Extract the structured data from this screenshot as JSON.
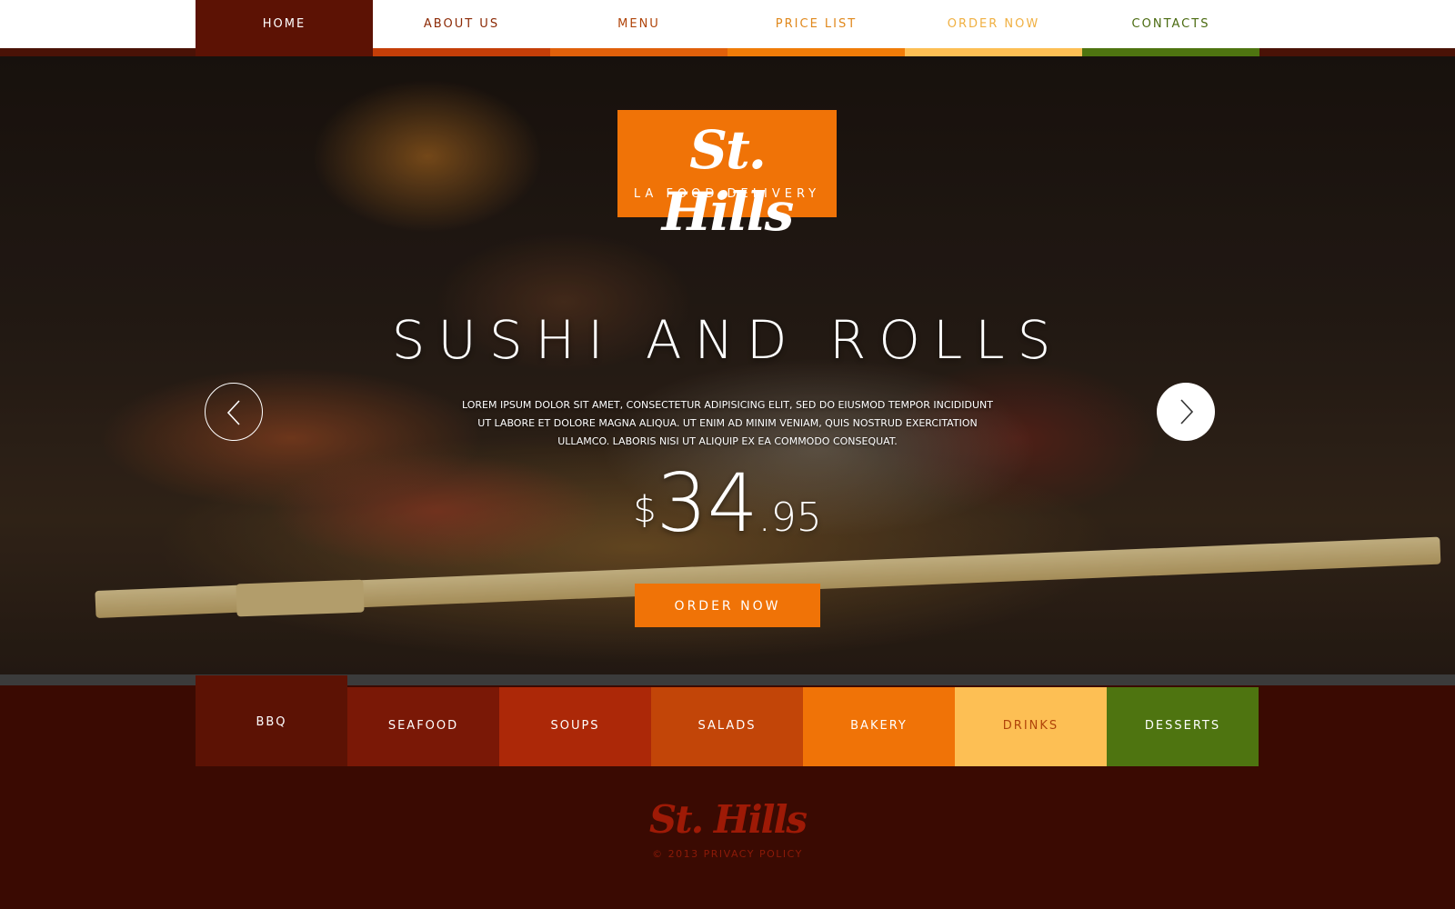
{
  "nav": {
    "items": [
      {
        "label": "HOME",
        "color": "#ffffff",
        "bar": "#5c1204",
        "active": true
      },
      {
        "label": "ABOUT US",
        "color": "#8c2a06",
        "bar": "#c43e08"
      },
      {
        "label": "MENU",
        "color": "#b0440a",
        "bar": "#e0600a"
      },
      {
        "label": "PRICE LIST",
        "color": "#e0881c",
        "bar": "#f07c08"
      },
      {
        "label": "ORDER NOW",
        "color": "#f0b042",
        "bar": "#fdbf54"
      },
      {
        "label": "CONTACTS",
        "color": "#4a6a10",
        "bar": "#4e7410"
      }
    ]
  },
  "hero": {
    "logo": {
      "name": "St. Hills",
      "tagline": "LA FOOD DELIVERY"
    },
    "title": "SUSHI AND ROLLS",
    "description": "LOREM IPSUM DOLOR SIT AMET, CONSECTETUR ADIPISICING ELIT, SED DO EIUSMOD TEMPOR INCIDIDUNT UT LABORE ET DOLORE MAGNA ALIQUA. UT ENIM AD MINIM VENIAM, QUIS NOSTRUD EXERCITATION ULLAMCO. LABORIS NISI UT ALIQUIP EX EA COMMODO CONSEQUAT.",
    "price": {
      "currency": "$",
      "amount": "34",
      "cents": ".95"
    },
    "order_button": "ORDER NOW",
    "prev_icon": "chevron-left-icon",
    "next_icon": "chevron-right-icon"
  },
  "categories": [
    {
      "label": "BBQ",
      "bg": "#5c1204",
      "color": "#ffffff"
    },
    {
      "label": "SEAFOOD",
      "bg": "#7a1806",
      "color": "#ffffff"
    },
    {
      "label": "SOUPS",
      "bg": "#ac2808",
      "color": "#ffffff"
    },
    {
      "label": "SALADS",
      "bg": "#c24508",
      "color": "#ffffff"
    },
    {
      "label": "BAKERY",
      "bg": "#f07307",
      "color": "#ffffff"
    },
    {
      "label": "DRINKS",
      "bg": "#fdbf54",
      "color": "#b0440a"
    },
    {
      "label": "DESSERTS",
      "bg": "#4e7410",
      "color": "#ffffff"
    }
  ],
  "footer": {
    "logo": "St. Hills",
    "copyright": "© 2013",
    "privacy": "PRIVACY POLICY"
  },
  "colors": {
    "accent": "#f07307",
    "background": "#3a0a02",
    "footer_text": "#8c1a08"
  }
}
